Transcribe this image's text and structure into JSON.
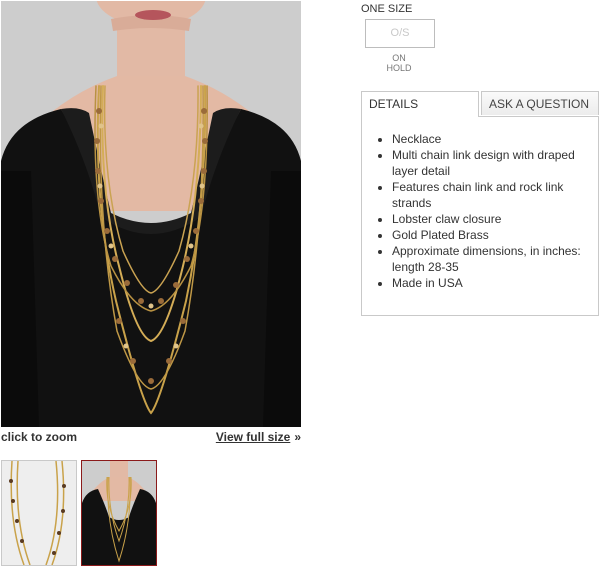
{
  "product": {
    "zoom_hint": "click to zoom",
    "view_full_size": "View full size",
    "view_full_arrow": "»"
  },
  "size": {
    "label": "ONE SIZE",
    "option": "O/S",
    "status": "ON HOLD"
  },
  "tabs": [
    {
      "label": "DETAILS",
      "active": true
    },
    {
      "label": "ASK A QUESTION",
      "active": false
    }
  ],
  "details": {
    "items": [
      "Necklace",
      "Multi chain link design with draped layer detail",
      "Features chain link and rock link strands",
      "Lobster claw closure",
      "Gold Plated Brass",
      "Approximate dimensions, in inches: length 28-35",
      "Made in USA"
    ]
  },
  "colors": {
    "active_thumb_border": "#8b1a1a",
    "chain_gold": "#c9a24a",
    "top_black": "#111111"
  }
}
